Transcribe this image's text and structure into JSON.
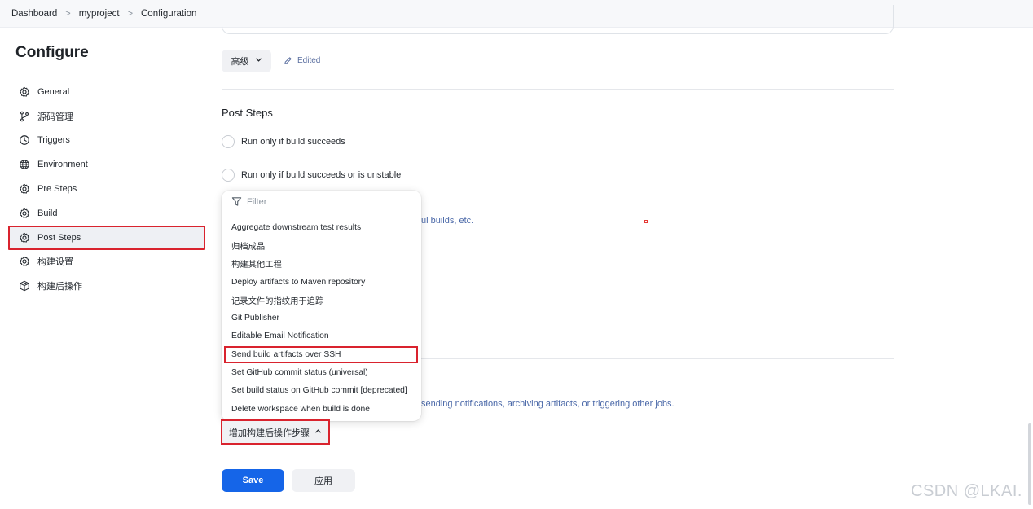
{
  "breadcrumb": {
    "items": [
      "Dashboard",
      "myproject",
      "Configuration"
    ]
  },
  "page_title": "Configure",
  "sidebar": {
    "items": [
      {
        "label": "General",
        "icon": "gear-icon"
      },
      {
        "label": "源码管理",
        "icon": "branch-icon"
      },
      {
        "label": "Triggers",
        "icon": "clock-icon"
      },
      {
        "label": "Environment",
        "icon": "globe-icon"
      },
      {
        "label": "Pre Steps",
        "icon": "gear-icon"
      },
      {
        "label": "Build",
        "icon": "gear-icon"
      },
      {
        "label": "Post Steps",
        "icon": "gear-icon",
        "active": true
      },
      {
        "label": "构建设置",
        "icon": "gear-icon"
      },
      {
        "label": "构建后操作",
        "icon": "cube-icon"
      }
    ]
  },
  "advanced": {
    "label": "高级",
    "edited": "Edited"
  },
  "post_steps": {
    "title": "Post Steps",
    "options": [
      "Run only if build succeeds",
      "Run only if build succeeds or is unstable"
    ],
    "partial_text_1": "ul builds, etc."
  },
  "post_build": {
    "partial_text": "sending notifications, archiving artifacts, or triggering other jobs.",
    "add_step_label": "增加构建后操作步骤"
  },
  "dropdown": {
    "filter_placeholder": "Filter",
    "items": [
      "Aggregate downstream test results",
      "归档成品",
      "构建其他工程",
      "Deploy artifacts to Maven repository",
      "记录文件的指纹用于追踪",
      "Git Publisher",
      "Editable Email Notification",
      "Send build artifacts over SSH",
      "Set GitHub commit status (universal)",
      "Set build status on GitHub commit [deprecated]",
      "Delete workspace when build is done"
    ],
    "highlighted_index": 7
  },
  "buttons": {
    "save": "Save",
    "apply": "应用"
  },
  "watermark": "CSDN @LKAI.",
  "colors": {
    "accent": "#1565e8",
    "highlight_border": "#d9232e",
    "link": "#4a68a8"
  }
}
